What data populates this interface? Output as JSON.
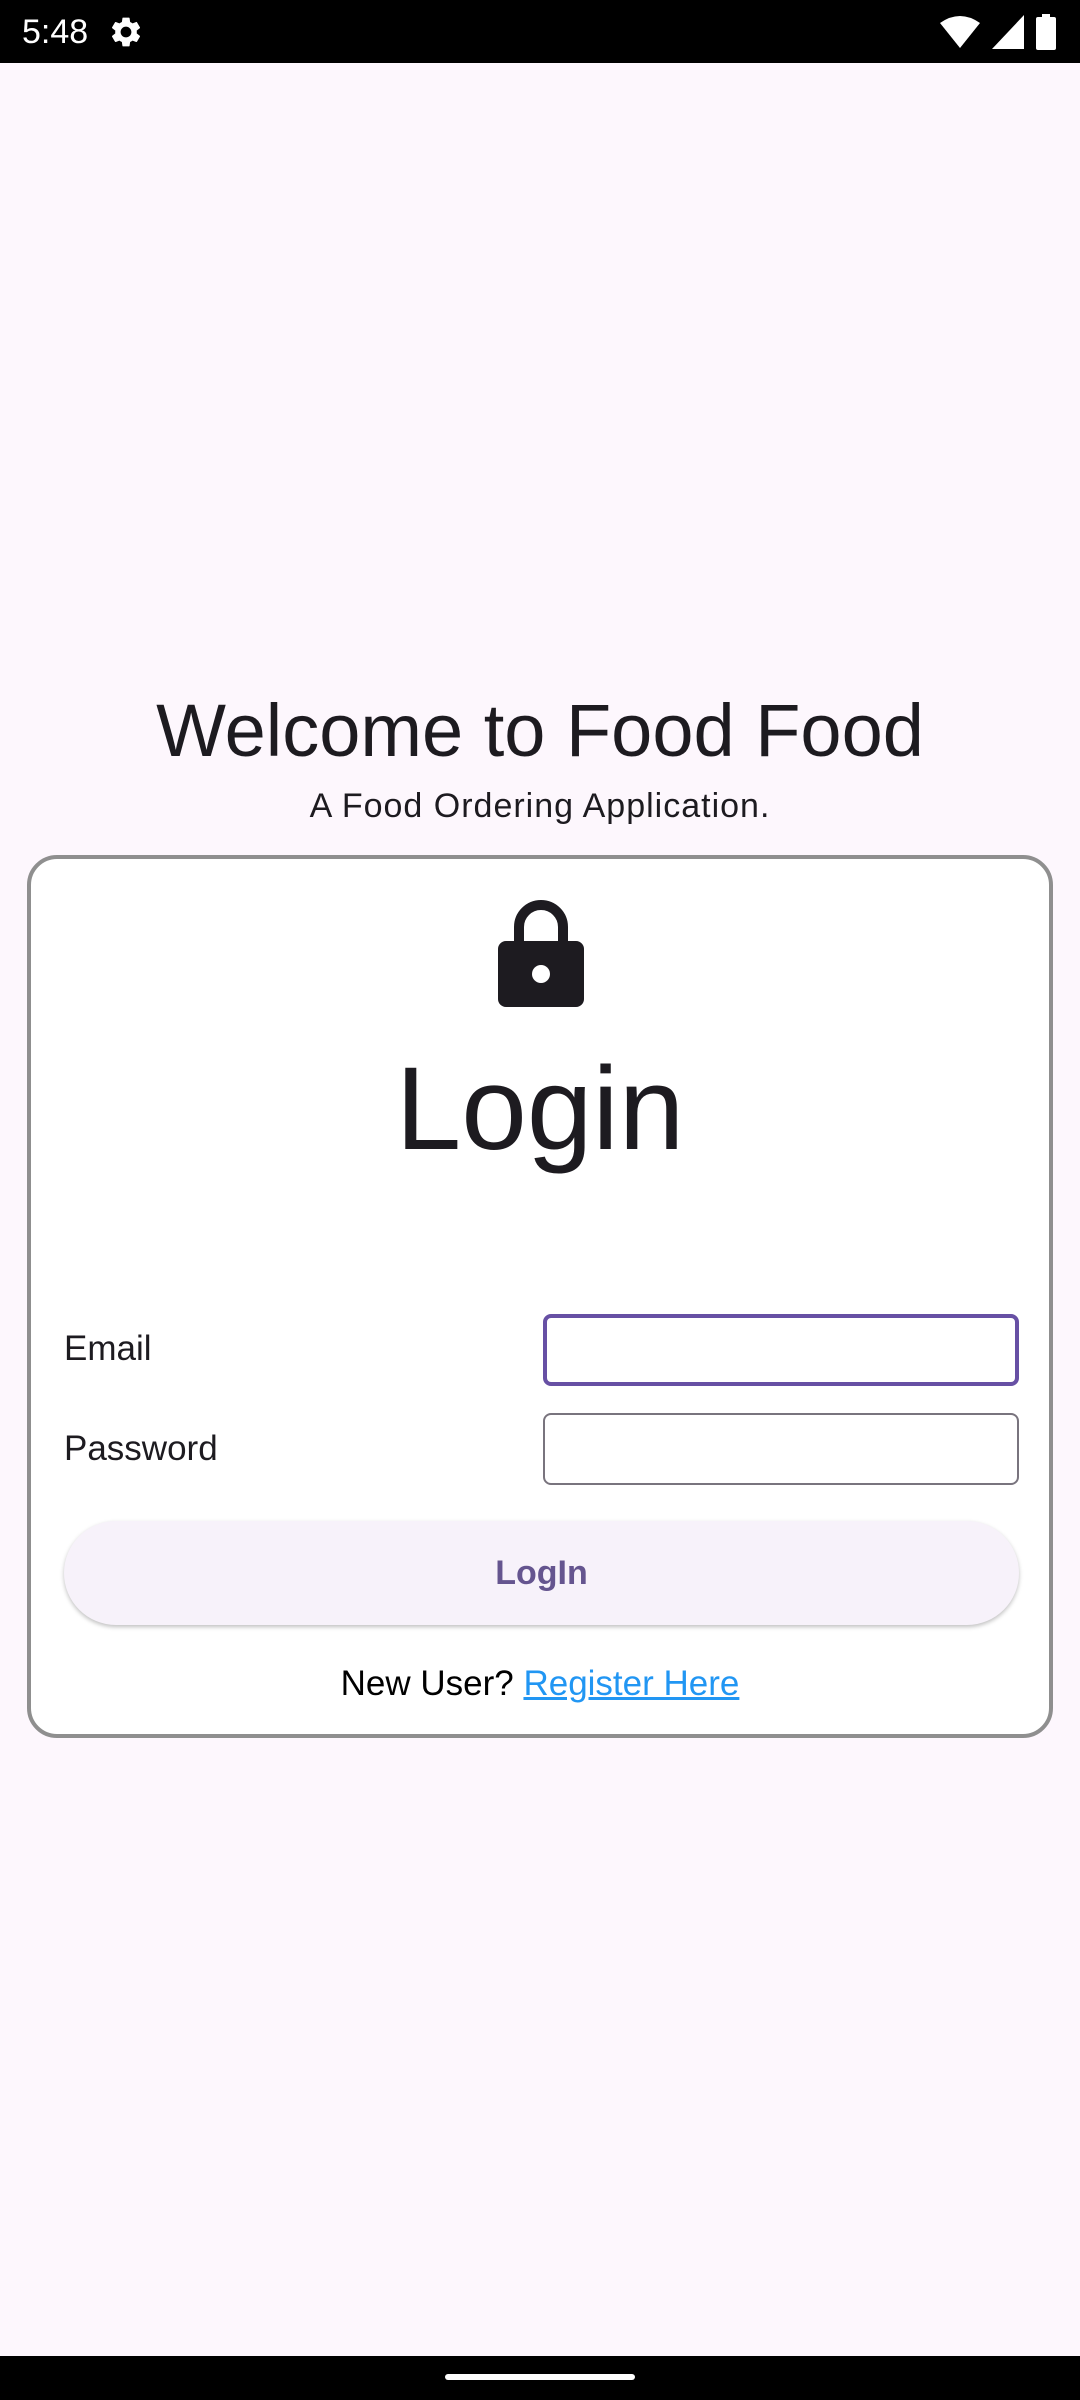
{
  "status_bar": {
    "time": "5:48",
    "icons": [
      "gear-icon",
      "wifi-icon",
      "signal-icon",
      "battery-icon"
    ]
  },
  "header": {
    "title": "Welcome to Food Food",
    "subtitle": "A Food Ordering Application."
  },
  "login_card": {
    "icon": "lock-icon",
    "heading": "Login",
    "email_label": "Email",
    "email_value": "",
    "password_label": "Password",
    "password_value": "",
    "button_label": "LogIn",
    "register_prompt": "New User?",
    "register_link": "Register Here"
  },
  "colors": {
    "background": "#fdf7fd",
    "accent": "#6750a4",
    "button_text": "#65558f",
    "link": "#2196f3",
    "card_border": "#8f8f8f"
  }
}
